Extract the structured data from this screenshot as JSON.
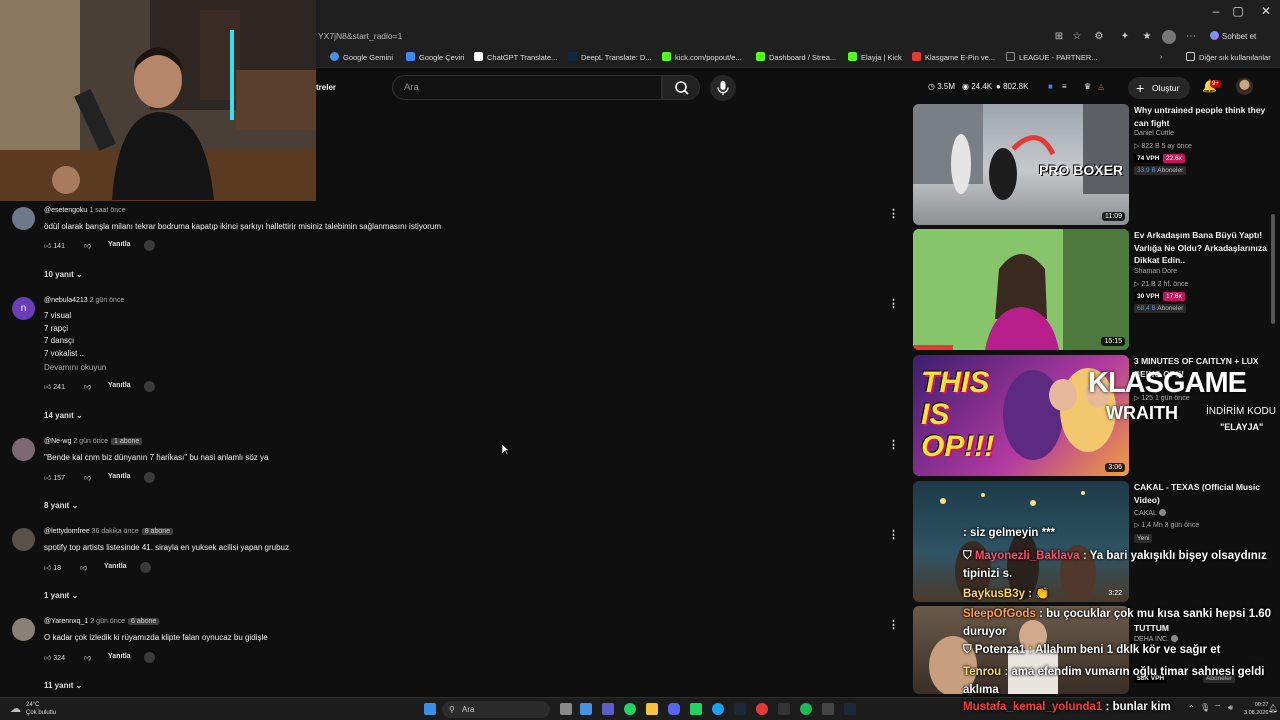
{
  "browser": {
    "url": "YX7jN8&start_radio=1",
    "chat_button": "Sohbet et",
    "bookmarks": [
      "Google Gemini",
      "Google Çeviri",
      "ChatGPT Translate...",
      "DeepL Translate: D...",
      "kick.com/popout/e...",
      "Dashboard / Strea...",
      "Elayja | Kick",
      "Klasgame E-Pin ve...",
      "LEAGUE - PARTNER..."
    ],
    "other_bookmarks": "Diğer sık kullanılanlar"
  },
  "youtube": {
    "sidebar_fragment": "treler",
    "search_placeholder": "Ara",
    "stats": {
      "live": "3.5M",
      "views": "24.4K",
      "subs": "802.8K"
    },
    "create_label": "Oluştur",
    "notif_count": "9+"
  },
  "comments": [
    {
      "user": "@esetengoku",
      "time": "1 saat önce",
      "badge": "",
      "lines": [
        "ödül olarak barışla milanı tekrar bodruma kapatıp ikinci şarkıyı hallettirir misiniz talebimin sağlanmasını istiyorum"
      ],
      "likes": "141",
      "reply": "Yanıtla",
      "replies": "10 yanıt",
      "readmore": ""
    },
    {
      "user": "@nebula4213",
      "time": "2 gün önce",
      "badge": "",
      "lines": [
        "7 visual",
        "7 rapçi",
        "7 dansçı",
        "7 vokalist .."
      ],
      "likes": "241",
      "reply": "Yanıtla",
      "replies": "14 yanıt",
      "readmore": "Devamını okuyun"
    },
    {
      "user": "@Ne-wg",
      "time": "2 gün önce",
      "badge": "1 abone",
      "lines": [
        "\"Bende kal cnm biz dünyanın 7 harikası\" bu nasi anlamlı söz ya"
      ],
      "likes": "157",
      "reply": "Yanıtla",
      "replies": "8 yanıt",
      "readmore": ""
    },
    {
      "user": "@lettydomfree",
      "time": "36 dakika önce",
      "badge": "8 abone",
      "lines": [
        "spotify top artists listesinde 41. sirayla en yuksek acilisi yapan grubuz"
      ],
      "likes": "18",
      "reply": "Yanıtla",
      "replies": "1 yanıt",
      "readmore": ""
    },
    {
      "user": "@Yarennxq_1",
      "time": "2 gün önce",
      "badge": "6 abone",
      "lines": [
        "O kadar çok izledik ki rüyamızda klipte falan oynucaz bu gidişle"
      ],
      "likes": "324",
      "reply": "Yanıtla",
      "replies": "11 yanıt",
      "readmore": ""
    }
  ],
  "recommended": [
    {
      "title": "Why untrained people think they can fight",
      "channel": "Daniel Cuttle",
      "meta": "▷ 822 B   5 ay önce",
      "vph": "74 VPH",
      "vph2": "22.6x",
      "subs_num": "33,9 B",
      "subs_label": "Aboneler",
      "duration": "11:09",
      "thumb_text": "PRO BOXER"
    },
    {
      "title": "Ev Arkadaşım Bana Büyü Yaptı! Varlığa Ne Oldu? Arkadaşlarınıza Dikkat Edin..",
      "channel": "Shaman Dore",
      "meta": "▷ 21 B   2 hf. önce",
      "vph": "30 VPH",
      "vph2": "17.6x",
      "subs_num": "68,4 B",
      "subs_label": "Aboneler",
      "duration": "15:15",
      "thumb_text": ""
    },
    {
      "title": "3 MINUTES OF CAITLYN + LUX BEING OP!!!",
      "channel": "",
      "meta": "▷ 125   1 gün önce",
      "vph": "",
      "vph2": "",
      "subs_num": "",
      "subs_label": "",
      "duration": "3:06",
      "thumb_text": "THIS IS OP!!!"
    },
    {
      "title": "CAKAL - TEXAS (Official Music Video)",
      "channel": "CAKAL",
      "meta": "▷ 1,4 Mn   3 gün önce",
      "vph": "",
      "vph2": "",
      "subs_num": "",
      "subs_label": "",
      "new_tag": "Yeni",
      "duration": "3:22",
      "thumb_text": ""
    },
    {
      "title": "TUTTUM",
      "channel": "DEHA INC.",
      "meta": "",
      "vph": "58K VPH",
      "vph2": "",
      "subs_num": "",
      "subs_label": "Aboneler",
      "duration": "",
      "thumb_text": ""
    }
  ],
  "overlay": {
    "brand": "KLASGAME",
    "wraith": "WRAITH",
    "discount": "İNDİRİM KODU",
    "code": "\"ELAYJA\"",
    "chat": [
      {
        "user": "",
        "msg": ": siz gelmeyin ***",
        "ucolor": "#7fb3ff"
      },
      {
        "user": "Mayonezli_Baklava",
        "msg": ": Ya bari yakışıklı bişey olsaydınız tipinizi s.",
        "ucolor": "#ff4d6d"
      },
      {
        "user": "BaykusB3y",
        "msg": ": 👏",
        "ucolor": "#ffd95a"
      },
      {
        "user": "SleepOfGods",
        "msg": ": bu çocuklar çok mu kısa sanki hepsi 1.60 duruyor",
        "ucolor": "#ff9f43"
      },
      {
        "user": "Potenza1",
        "msg": ": Allahım beni 1 dklk kör ve sağır et",
        "ucolor": "#ffffff"
      },
      {
        "user": "Tenrou",
        "msg": ": ama efendim vumarın oğlu timar sahnesi geldi aklıma",
        "ucolor": "#f5d76e"
      },
      {
        "user": "Mustafa_kemal_yolunda1",
        "msg": ": bunlar kim",
        "ucolor": "#ff3b3b"
      }
    ]
  },
  "taskbar": {
    "weather_temp": "24°C",
    "weather_desc": "Çok bulutlu",
    "search": "Ara",
    "time": "00:27",
    "date": "3.08.2026"
  }
}
